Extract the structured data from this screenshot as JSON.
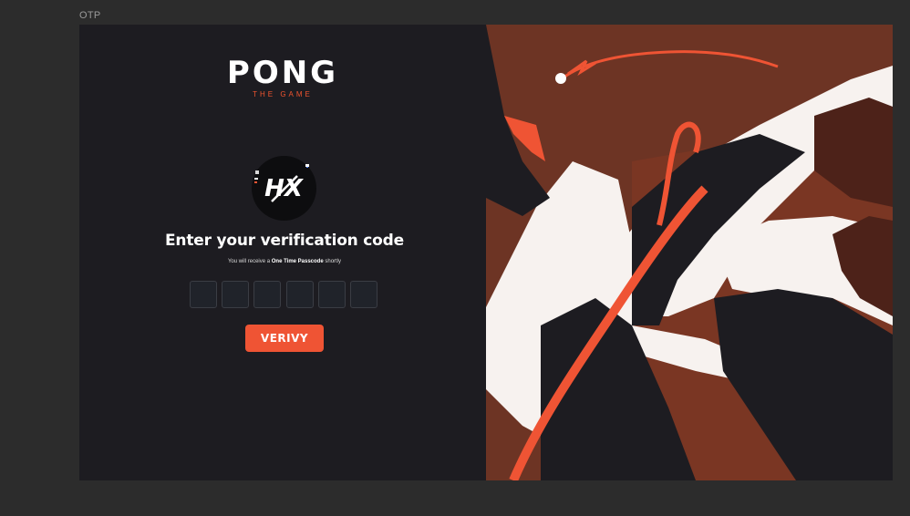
{
  "frame": {
    "label": "OTP"
  },
  "logo": {
    "title": "PONG",
    "subtitle": "THE GAME"
  },
  "avatar": {
    "icon": "hx-logo-icon"
  },
  "form": {
    "heading": "Enter your verification code",
    "subtext_prefix": "You will receive a ",
    "subtext_bold": "One Time Passcode",
    "subtext_suffix": " shortly",
    "otp_digits": [
      "",
      "",
      "",
      "",
      "",
      ""
    ],
    "verify_label": "VERIVY"
  },
  "colors": {
    "left_panel_bg": "#1d1c21",
    "right_panel_bg": "#6d3424",
    "accent": "#ef5434",
    "otp_box_bg": "#20232a"
  }
}
